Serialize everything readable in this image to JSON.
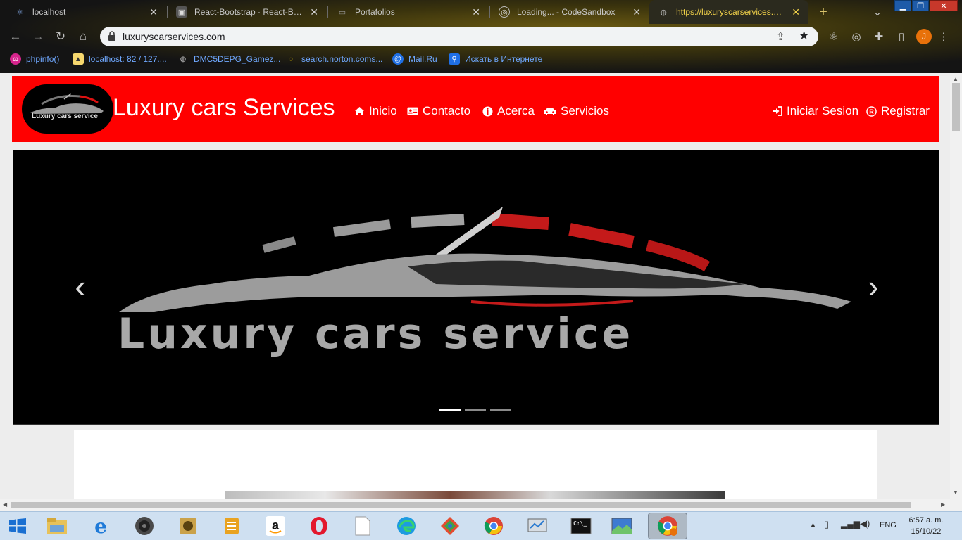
{
  "browser": {
    "tabs": [
      {
        "title": "localhost",
        "active": false
      },
      {
        "title": "React-Bootstrap · React-Bootstrap",
        "active": false
      },
      {
        "title": "Portafolios",
        "active": false
      },
      {
        "title": "Loading... - CodeSandbox",
        "active": false
      },
      {
        "title": "https://luxuryscarservices.com",
        "active": true
      }
    ],
    "new_tab_label": "+",
    "tab_search_label": "⌄",
    "url": "luxuryscarservices.com",
    "profile_initial": "J",
    "bookmarks": [
      {
        "label": "phpinfo()"
      },
      {
        "label": "localhost: 82 / 127...."
      },
      {
        "label": "DMC5DEPG_Gamez..."
      },
      {
        "label": "search.norton.coms..."
      },
      {
        "label": "Mail.Ru"
      },
      {
        "label": "Искать в Интернете"
      }
    ]
  },
  "site": {
    "logo_text": "Luxury cars service",
    "brand": "Luxury cars Services",
    "nav": {
      "inicio": "Inicio",
      "contacto": "Contacto",
      "acerca": "Acerca",
      "servicios": "Servicios",
      "login": "Iniciar Sesion",
      "register": "Registrar"
    },
    "carousel": {
      "slide_text": "Luxury cars service",
      "prev_label": "‹",
      "next_label": "›",
      "slide_count": 3,
      "active_slide": 1
    }
  },
  "taskbar": {
    "language": "ENG",
    "time": "6:57 a. m.",
    "date": "15/10/22"
  },
  "colors": {
    "nav_red": "#ff0000",
    "active_tab_text": "#f2d24a",
    "profile_orange": "#e8710a"
  }
}
